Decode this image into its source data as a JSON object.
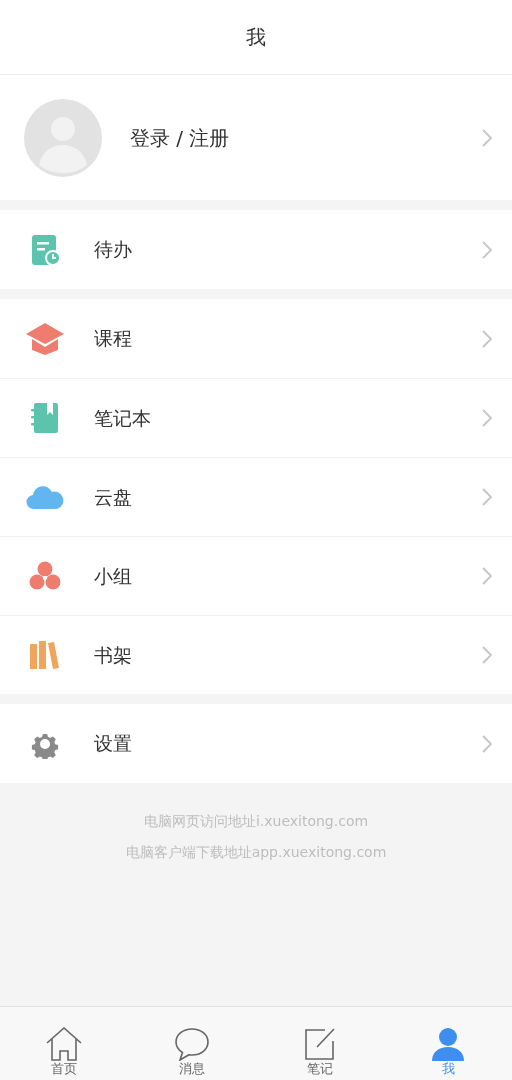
{
  "header": {
    "title": "我"
  },
  "profile": {
    "label": "登录 / 注册"
  },
  "groups": [
    [
      {
        "kind": "todo",
        "label": "待办"
      }
    ],
    [
      {
        "kind": "course",
        "label": "课程"
      },
      {
        "kind": "notebook",
        "label": "笔记本"
      },
      {
        "kind": "cloud",
        "label": "云盘"
      },
      {
        "kind": "group",
        "label": "小组"
      },
      {
        "kind": "bookshelf",
        "label": "书架"
      }
    ],
    [
      {
        "kind": "settings",
        "label": "设置"
      }
    ]
  ],
  "footer": [
    "电脑网页访问地址i.xuexitong.com",
    "电脑客户端下载地址app.xuexitong.com"
  ],
  "tabs": [
    {
      "kind": "home",
      "label": "首页",
      "selected": false
    },
    {
      "kind": "message",
      "label": "消息",
      "selected": false
    },
    {
      "kind": "note",
      "label": "笔记",
      "selected": false
    },
    {
      "kind": "me",
      "label": "我",
      "selected": true
    }
  ]
}
